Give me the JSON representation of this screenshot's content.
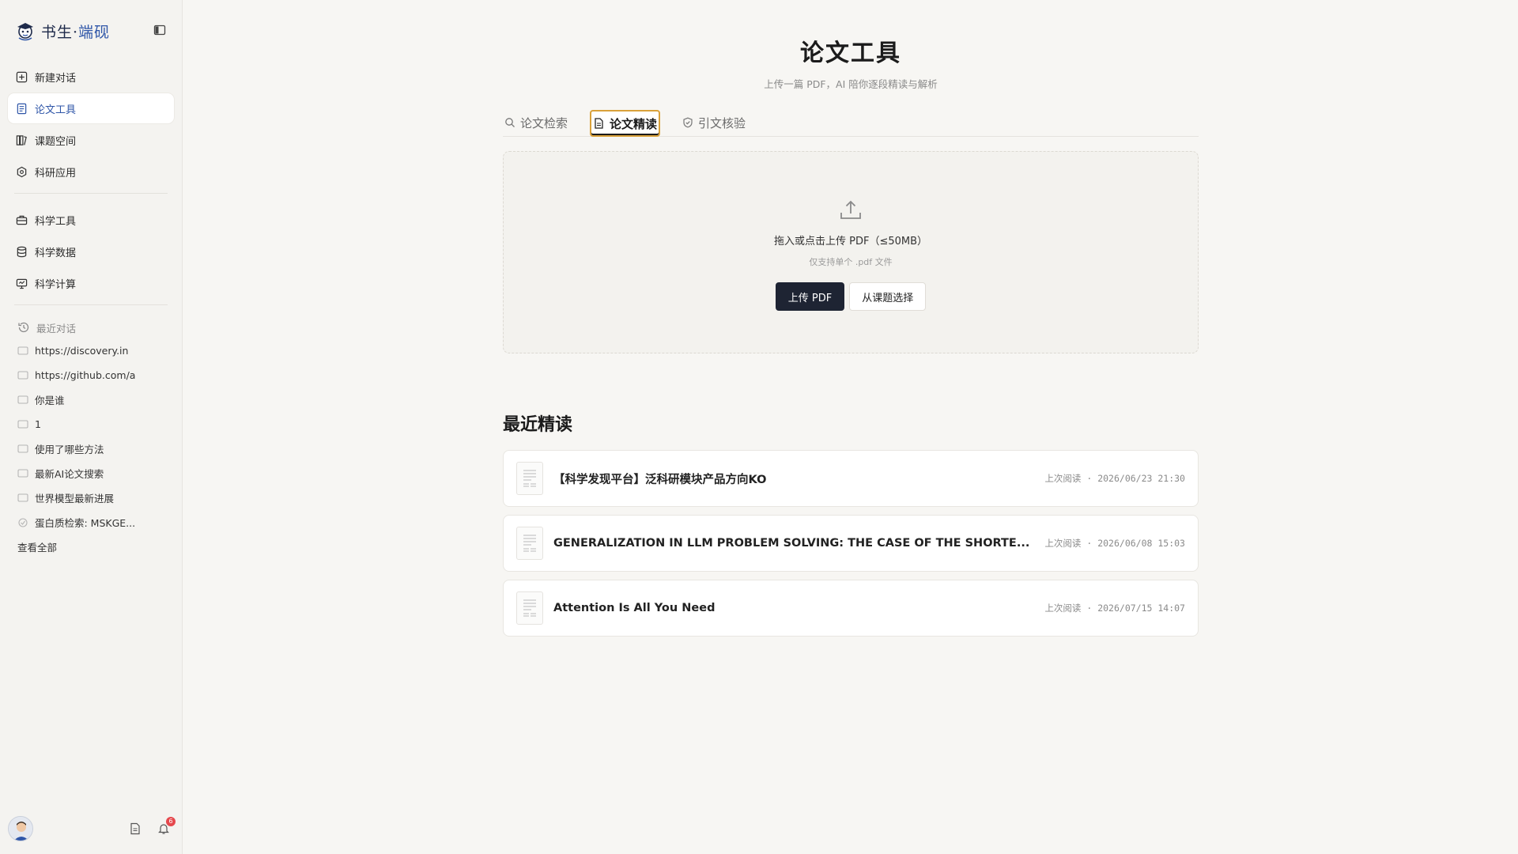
{
  "brand": {
    "name": "书生·",
    "name_accent": "端砚"
  },
  "nav": {
    "primary": [
      {
        "label": "新建对话",
        "icon": "plus-square-icon"
      },
      {
        "label": "论文工具",
        "icon": "document-icon",
        "active": true
      },
      {
        "label": "课题空间",
        "icon": "library-icon"
      },
      {
        "label": "科研应用",
        "icon": "hexagon-icon"
      }
    ],
    "secondary": [
      {
        "label": "科学工具",
        "icon": "toolbox-icon"
      },
      {
        "label": "科学数据",
        "icon": "database-icon"
      },
      {
        "label": "科学计算",
        "icon": "monitor-icon"
      }
    ]
  },
  "recent": {
    "header": "最近对话",
    "items": [
      "https://discovery.in",
      "https://github.com/a",
      "你是谁",
      "1",
      "使用了哪些方法",
      "最新AI论文搜索",
      "世界模型最新进展",
      "蛋白质检索: MSKGE..."
    ],
    "view_all": "查看全部"
  },
  "footer": {
    "notification_count": "6"
  },
  "page": {
    "title": "论文工具",
    "subtitle": "上传一篇 PDF，AI 陪你逐段精读与解析"
  },
  "tabs": [
    {
      "label": "论文检索",
      "icon": "search-icon"
    },
    {
      "label": "论文精读",
      "icon": "file-icon",
      "active": true
    },
    {
      "label": "引文核验",
      "icon": "shield-check-icon"
    }
  ],
  "upload": {
    "text": "拖入或点击上传 PDF（≤50MB）",
    "hint": "仅支持单个 .pdf 文件",
    "primary_button": "上传 PDF",
    "secondary_button": "从课题选择"
  },
  "recent_reads": {
    "title": "最近精读",
    "items": [
      {
        "title": "【科学发现平台】泛科研模块产品方向KO",
        "meta": "上次阅读 · 2026/06/23 21:30"
      },
      {
        "title": "GENERALIZATION IN LLM PROBLEM SOLVING: THE CASE OF THE SHORTE...",
        "meta": "上次阅读 · 2026/06/08 15:03"
      },
      {
        "title": "Attention Is All You Need",
        "meta": "上次阅读 · 2026/07/15 14:07"
      }
    ]
  },
  "colors": {
    "accent": "#2f56a8",
    "primary_button": "#1e2433",
    "active_tab_outline": "#d9a13b",
    "badge": "#e5484d"
  }
}
